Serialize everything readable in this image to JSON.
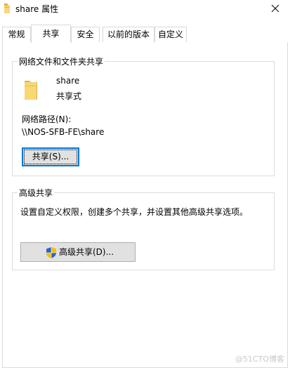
{
  "window": {
    "title": "share 属性"
  },
  "tabs": [
    {
      "label": "常规"
    },
    {
      "label": "共享"
    },
    {
      "label": "安全"
    },
    {
      "label": "以前的版本"
    },
    {
      "label": "自定义"
    }
  ],
  "network_share": {
    "group_title": "网络文件和文件夹共享",
    "folder_name": "share",
    "share_status": "共享式",
    "path_label": "网络路径(N):",
    "path_value": "\\\\NOS-SFB-FE\\share",
    "share_button": "共享(S)..."
  },
  "advanced_share": {
    "group_title": "高级共享",
    "description": "设置自定义权限，创建多个共享，并设置其他高级共享选项。",
    "button": "高级共享(D)..."
  },
  "watermark": "@51CTO博客",
  "colors": {
    "folder_yellow": "#f8d775",
    "folder_dark": "#e0b24a",
    "focus_blue": "#0078d7",
    "button_gray": "#e1e1e1"
  },
  "icons": {
    "title": "folder-icon",
    "close": "close-icon",
    "big_folder": "folder-icon",
    "uac": "uac-shield-icon"
  }
}
